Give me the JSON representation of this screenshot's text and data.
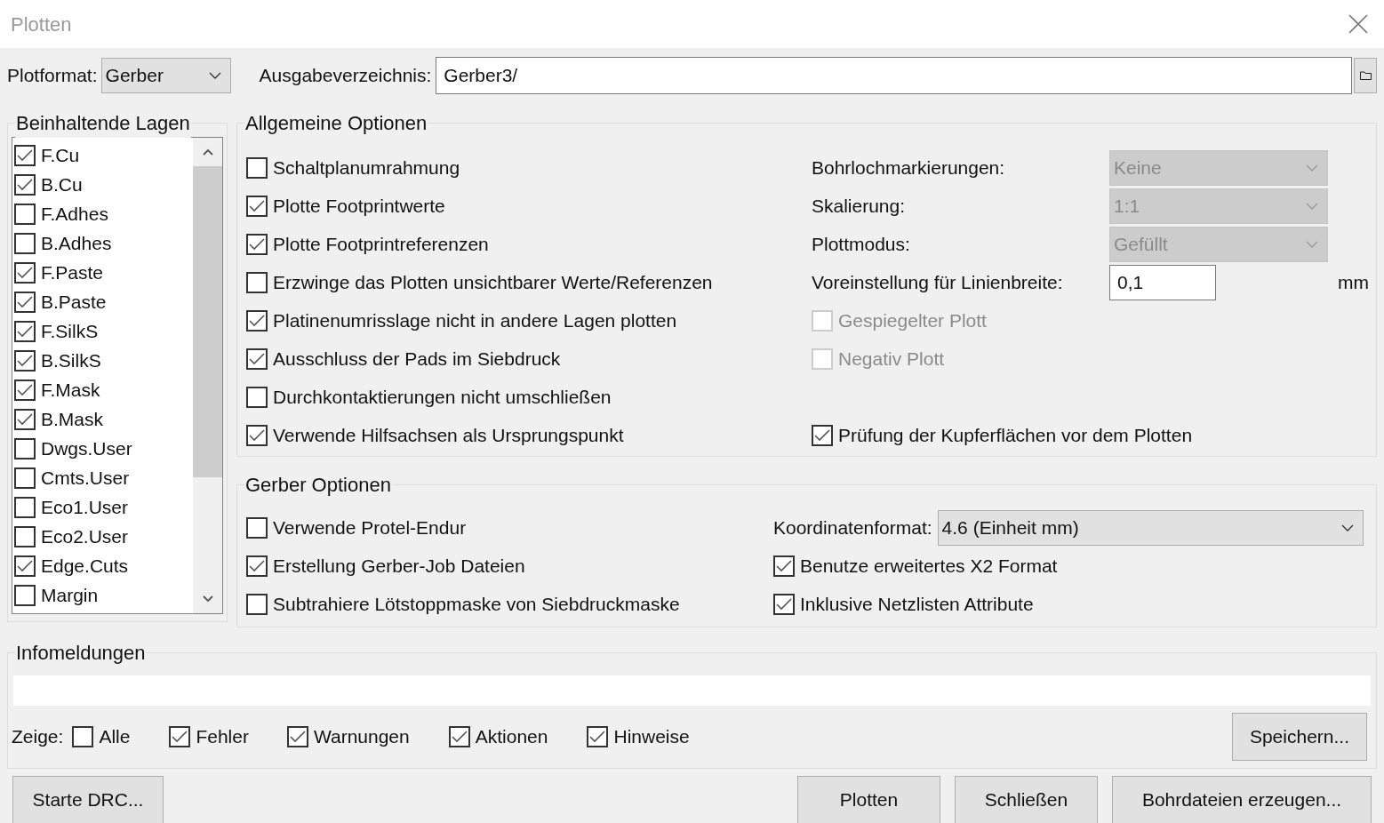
{
  "window": {
    "title": "Plotten"
  },
  "plot_format": {
    "label": "Plotformat:",
    "value": "Gerber"
  },
  "output_directory": {
    "label": "Ausgabeverzeichnis:",
    "value": "Gerber3/"
  },
  "layers": {
    "title": "Beinhaltende Lagen",
    "items": [
      {
        "label": "F.Cu",
        "checked": true
      },
      {
        "label": "B.Cu",
        "checked": true
      },
      {
        "label": "F.Adhes",
        "checked": false
      },
      {
        "label": "B.Adhes",
        "checked": false
      },
      {
        "label": "F.Paste",
        "checked": true
      },
      {
        "label": "B.Paste",
        "checked": true
      },
      {
        "label": "F.SilkS",
        "checked": true
      },
      {
        "label": "B.SilkS",
        "checked": true
      },
      {
        "label": "F.Mask",
        "checked": true
      },
      {
        "label": "B.Mask",
        "checked": true
      },
      {
        "label": "Dwgs.User",
        "checked": false
      },
      {
        "label": "Cmts.User",
        "checked": false
      },
      {
        "label": "Eco1.User",
        "checked": false
      },
      {
        "label": "Eco2.User",
        "checked": false
      },
      {
        "label": "Edge.Cuts",
        "checked": true
      },
      {
        "label": "Margin",
        "checked": false
      }
    ]
  },
  "general_options": {
    "title": "Allgemeine Optionen",
    "left": [
      {
        "label": "Schaltplanumrahmung",
        "checked": false
      },
      {
        "label": "Plotte Footprintwerte",
        "checked": true
      },
      {
        "label": "Plotte Footprintreferenzen",
        "checked": true
      },
      {
        "label": "Erzwinge das Plotten unsichtbarer Werte/Referenzen",
        "checked": false
      },
      {
        "label": "Platinenumrisslage nicht in andere Lagen plotten",
        "checked": true
      },
      {
        "label": "Ausschluss der Pads im Siebdruck",
        "checked": true
      },
      {
        "label": "Durchkontaktierungen nicht umschließen",
        "checked": false
      },
      {
        "label": "Verwende Hilfsachsen als Ursprungspunkt",
        "checked": true
      }
    ],
    "right": [
      {
        "kind": "select",
        "label": "Bohrlochmarkierungen:",
        "value": "Keine",
        "disabled": true
      },
      {
        "kind": "select",
        "label": "Skalierung:",
        "value": "1:1",
        "disabled": true
      },
      {
        "kind": "select",
        "label": "Plottmodus:",
        "value": "Gefüllt",
        "disabled": true
      },
      {
        "kind": "input",
        "label": "Voreinstellung für Linienbreite:",
        "value": "0,1",
        "unit": "mm"
      },
      {
        "kind": "checkbox",
        "label": "Gespiegelter Plott",
        "checked": false,
        "disabled": true
      },
      {
        "kind": "checkbox",
        "label": "Negativ Plott",
        "checked": false,
        "disabled": true
      }
    ],
    "zone_check": {
      "label": "Prüfung der Kupferflächen vor dem Plotten",
      "checked": true
    }
  },
  "gerber_options": {
    "title": "Gerber Optionen",
    "left": [
      {
        "label": "Verwende Protel-Endur",
        "checked": false
      },
      {
        "label": "Erstellung Gerber-Job Dateien",
        "checked": true
      },
      {
        "label": "Subtrahiere Lötstoppmaske von Siebdruckmaske",
        "checked": false
      }
    ],
    "coordinate_format": {
      "label": "Koordinatenformat:",
      "value": "4.6 (Einheit mm)"
    },
    "right": [
      {
        "label": "Benutze erweitertes X2 Format",
        "checked": true
      },
      {
        "label": "Inklusive Netzlisten Attribute",
        "checked": true
      }
    ]
  },
  "messages": {
    "title": "Infomeldungen",
    "show_label": "Zeige:",
    "filters": [
      {
        "label": "Alle",
        "checked": false
      },
      {
        "label": "Fehler",
        "checked": true
      },
      {
        "label": "Warnungen",
        "checked": true
      },
      {
        "label": "Aktionen",
        "checked": true
      },
      {
        "label": "Hinweise",
        "checked": true
      }
    ],
    "save_button": "Speichern..."
  },
  "buttons": {
    "left": "Starte DRC...",
    "right": [
      "Plotten",
      "Schließen",
      "Bohrdateien erzeugen..."
    ]
  }
}
